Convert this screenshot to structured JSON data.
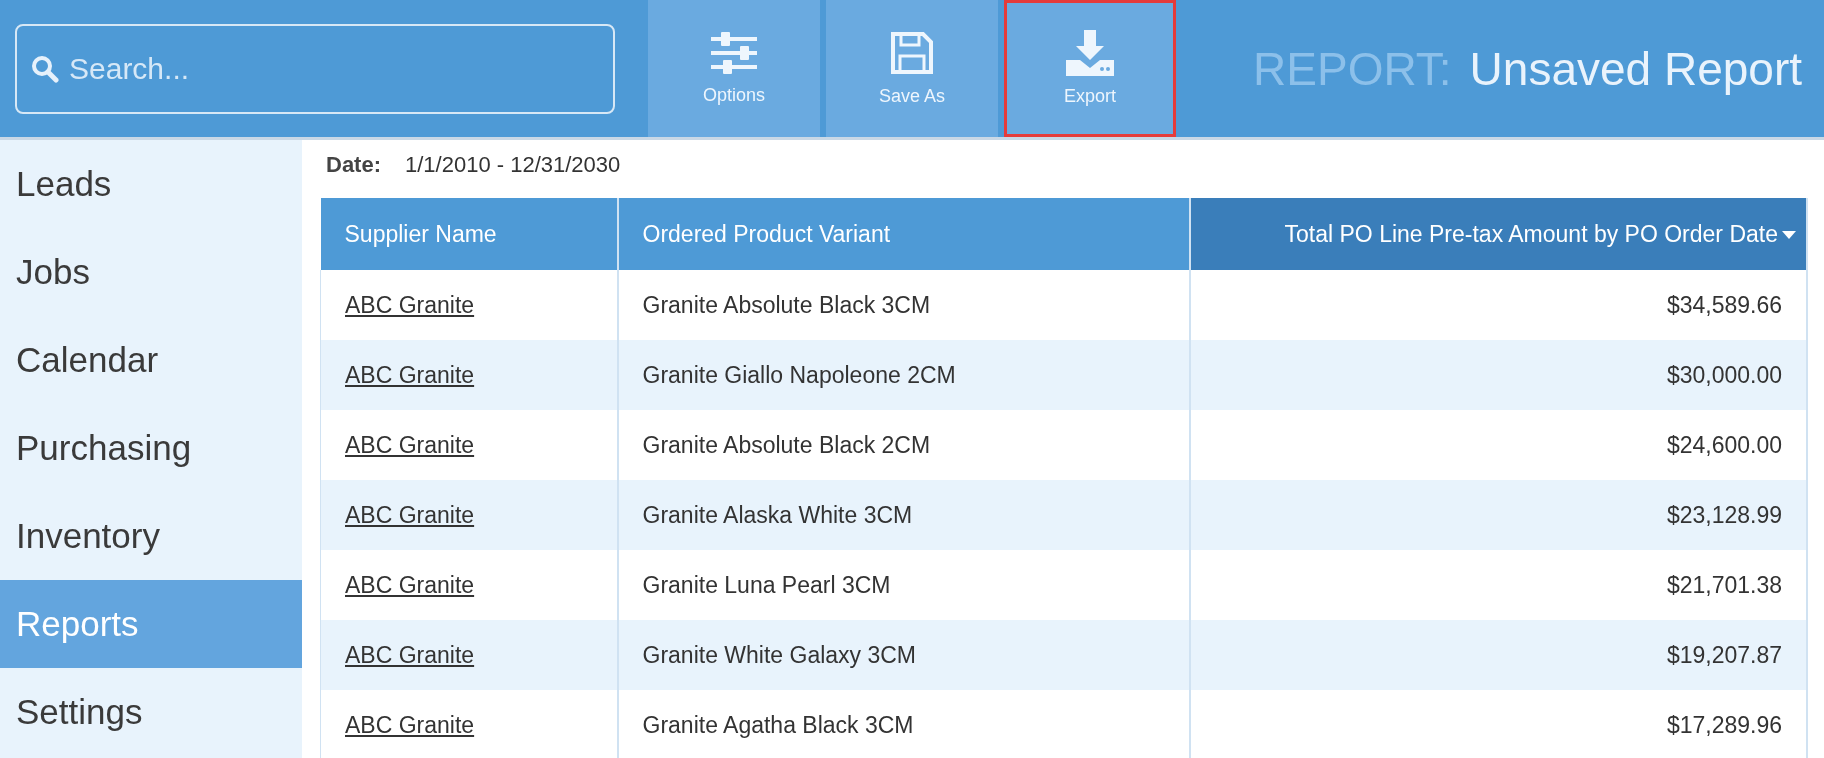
{
  "search": {
    "placeholder": "Search..."
  },
  "toolbar": [
    {
      "label": "Options",
      "kind": "sliders",
      "highlighted": false
    },
    {
      "label": "Save As",
      "kind": "save",
      "highlighted": false
    },
    {
      "label": "Export",
      "kind": "export",
      "highlighted": true
    }
  ],
  "title": {
    "prefix": "REPORT:",
    "name": "Unsaved Report"
  },
  "sidebar": {
    "items": [
      {
        "label": "Leads",
        "selected": false
      },
      {
        "label": "Jobs",
        "selected": false
      },
      {
        "label": "Calendar",
        "selected": false
      },
      {
        "label": "Purchasing",
        "selected": false
      },
      {
        "label": "Inventory",
        "selected": false
      },
      {
        "label": "Reports",
        "selected": true
      },
      {
        "label": "Settings",
        "selected": false
      }
    ]
  },
  "filter": {
    "label": "Date:",
    "value": "1/1/2010 - 12/31/2030"
  },
  "table": {
    "columns": [
      {
        "label": "Supplier Name",
        "sorted": false
      },
      {
        "label": "Ordered Product Variant",
        "sorted": false
      },
      {
        "label": "Total PO Line Pre-tax Amount by PO Order Date",
        "sorted": true
      }
    ],
    "rows": [
      [
        "ABC Granite",
        "Granite Absolute Black 3CM",
        "$34,589.66"
      ],
      [
        "ABC Granite",
        "Granite Giallo Napoleone 2CM",
        "$30,000.00"
      ],
      [
        "ABC Granite",
        "Granite Absolute Black 2CM",
        "$24,600.00"
      ],
      [
        "ABC Granite",
        "Granite Alaska White 3CM",
        "$23,128.99"
      ],
      [
        "ABC Granite",
        "Granite Luna Pearl 3CM",
        "$21,701.38"
      ],
      [
        "ABC Granite",
        "Granite White Galaxy 3CM",
        "$19,207.87"
      ],
      [
        "ABC Granite",
        "Granite Agatha Black 3CM",
        "$17,289.96"
      ]
    ]
  }
}
